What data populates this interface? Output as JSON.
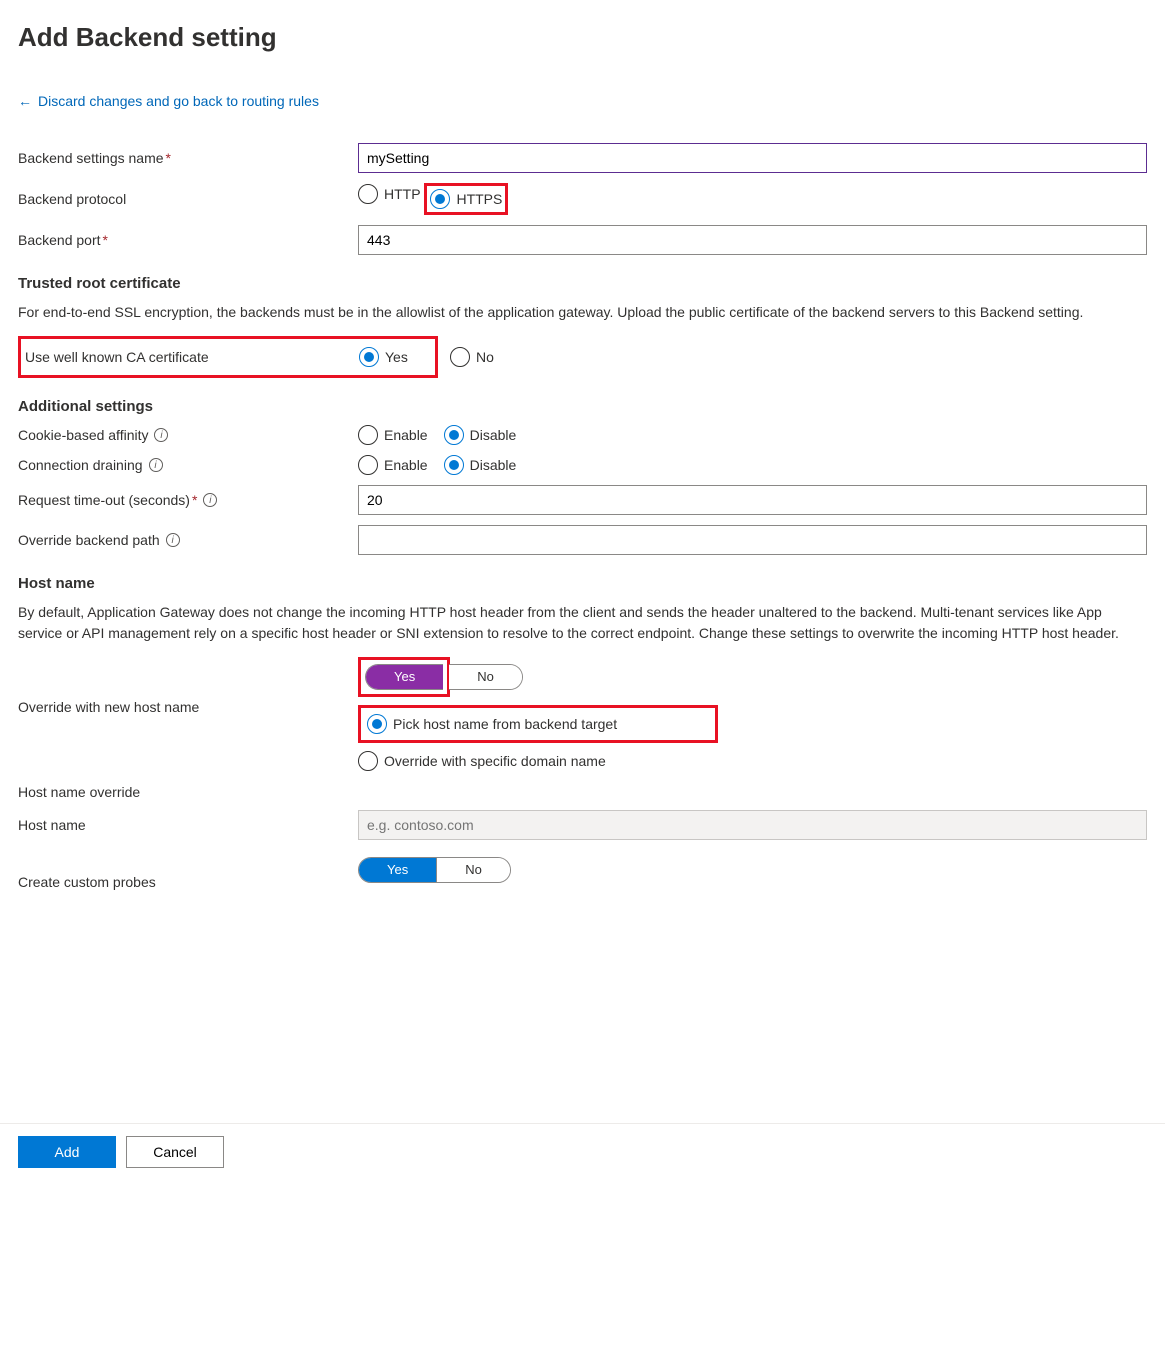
{
  "title": "Add Backend setting",
  "back_link": "Discard changes and go back to routing rules",
  "fields": {
    "name_label": "Backend settings name",
    "name_value": "mySetting",
    "protocol_label": "Backend protocol",
    "protocol_http": "HTTP",
    "protocol_https": "HTTPS",
    "port_label": "Backend port",
    "port_value": "443"
  },
  "trusted": {
    "title": "Trusted root certificate",
    "desc": "For end-to-end SSL encryption, the backends must be in the allowlist of the application gateway. Upload the public certificate of the backend servers to this Backend setting.",
    "ca_label": "Use well known CA certificate",
    "yes": "Yes",
    "no": "No"
  },
  "additional": {
    "title": "Additional settings",
    "cookie_label": "Cookie-based affinity",
    "drain_label": "Connection draining",
    "enable": "Enable",
    "disable": "Disable",
    "timeout_label": "Request time-out (seconds)",
    "timeout_value": "20",
    "override_path_label": "Override backend path",
    "override_path_value": ""
  },
  "hostname": {
    "title": "Host name",
    "desc": "By default, Application Gateway does not change the incoming HTTP host header from the client and sends the header unaltered to the backend. Multi-tenant services like App service or API management rely on a specific host header or SNI extension to resolve to the correct endpoint. Change these settings to overwrite the incoming HTTP host header.",
    "override_label": "Override with new host name",
    "yes": "Yes",
    "no": "No",
    "host_override_label": "Host name override",
    "pick_backend": "Pick host name from backend target",
    "specific_domain": "Override with specific domain name",
    "host_label": "Host name",
    "host_placeholder": "e.g. contoso.com",
    "probe_label": "Create custom probes"
  },
  "footer": {
    "add": "Add",
    "cancel": "Cancel"
  }
}
